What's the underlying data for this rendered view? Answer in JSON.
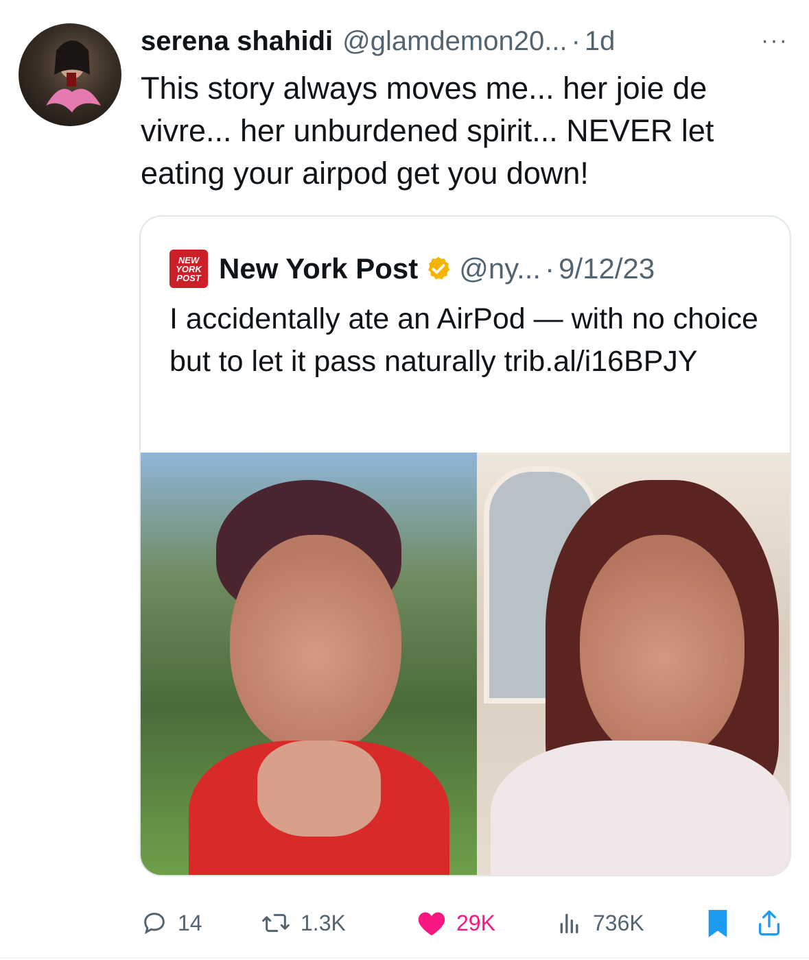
{
  "tweet": {
    "author_name": "serena shahidi",
    "author_handle": "@glamdemon20...",
    "separator": "·",
    "time": "1d",
    "more": "···",
    "text": "This story always moves me... her joie de vivre... her unburdened spirit... NEVER let eating your airpod get you down!"
  },
  "quoted": {
    "logo_text": [
      "NEW",
      "YORK",
      "POST"
    ],
    "name": "New York Post",
    "handle": "@ny...",
    "separator": "·",
    "date": "9/12/23",
    "text": "I accidentally ate an AirPod — with no choice but to let it pass naturally trib.al/i16BPJY",
    "verified_color": "#f4b400",
    "logo_color": "#cc1f27"
  },
  "actions": {
    "replies": "14",
    "reposts": "1.3K",
    "likes": "29K",
    "views": "736K"
  },
  "colors": {
    "like": "#f91880",
    "bookmark": "#1d9bf0",
    "muted": "#536471"
  }
}
